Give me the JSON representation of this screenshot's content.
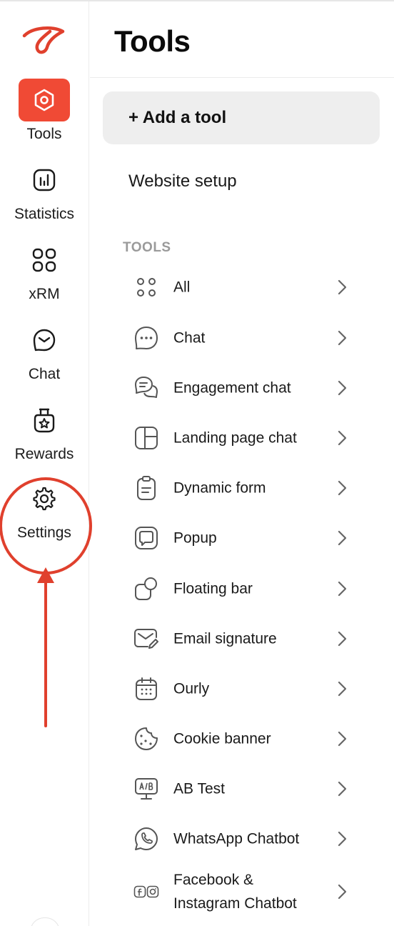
{
  "sidebar": {
    "logo_icon": "loop-logo-icon",
    "items": [
      {
        "label": "Tools",
        "icon": "hexagon-icon",
        "active": true
      },
      {
        "label": "Statistics",
        "icon": "bar-chart-icon",
        "active": false
      },
      {
        "label": "xRM",
        "icon": "grid-icon",
        "active": false
      },
      {
        "label": "Chat",
        "icon": "chat-bubble-icon",
        "active": false
      },
      {
        "label": "Rewards",
        "icon": "reward-badge-icon",
        "active": false
      },
      {
        "label": "Settings",
        "icon": "gear-icon",
        "active": false
      }
    ]
  },
  "header": {
    "title": "Tools"
  },
  "main": {
    "add_tool_label": "+ Add a tool",
    "website_setup_label": "Website setup",
    "section_label": "TOOLS",
    "tools": [
      {
        "label": "All",
        "icon": "dots-grid-icon"
      },
      {
        "label": "Chat",
        "icon": "chat-dots-icon"
      },
      {
        "label": "Engagement chat",
        "icon": "engagement-chat-icon"
      },
      {
        "label": "Landing page chat",
        "icon": "landing-page-icon"
      },
      {
        "label": "Dynamic form",
        "icon": "clipboard-icon"
      },
      {
        "label": "Popup",
        "icon": "popup-icon"
      },
      {
        "label": "Floating bar",
        "icon": "floating-bar-icon"
      },
      {
        "label": "Email signature",
        "icon": "email-signature-icon"
      },
      {
        "label": "Ourly",
        "icon": "calendar-icon"
      },
      {
        "label": "Cookie banner",
        "icon": "cookie-icon"
      },
      {
        "label": "AB Test",
        "icon": "ab-test-icon"
      },
      {
        "label": "WhatsApp Chatbot",
        "icon": "whatsapp-icon"
      },
      {
        "label": "Facebook & Instagram Chatbot",
        "icon": "facebook-instagram-icon"
      }
    ]
  },
  "colors": {
    "accent": "#f04a35",
    "annotation": "#e0402d",
    "muted_text": "#9a9a9a",
    "button_bg": "#eeeeee"
  }
}
